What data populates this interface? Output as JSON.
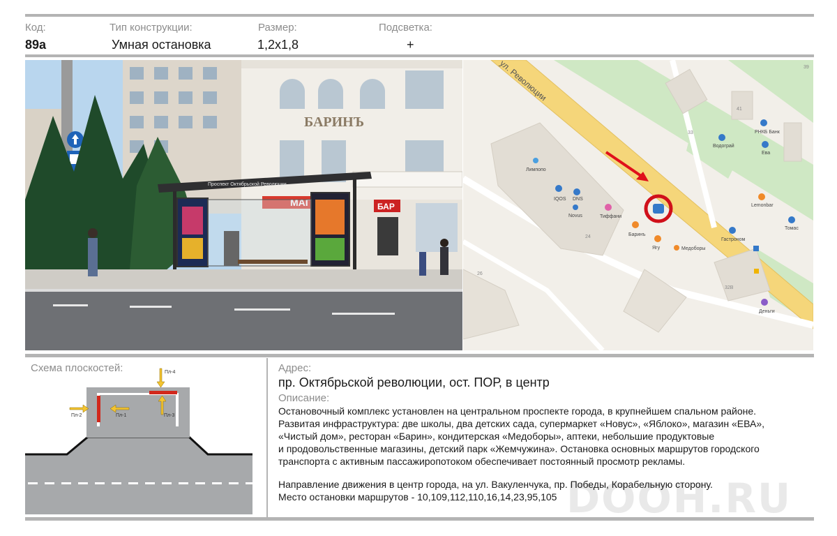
{
  "header": {
    "code_label": "Код:",
    "code_value": "89а",
    "type_label": "Тип конструкции:",
    "type_value": "Умная остановка",
    "size_label": "Размер:",
    "size_value": "1,2х1,8",
    "light_label": "Подсветка:",
    "light_value": "+"
  },
  "photo": {
    "building_sign": "БАРИНЪ",
    "shop_sign": "МАГ",
    "bar_sign": "БАР",
    "shelter_roof_text": "Проспект Октябрьской Революции"
  },
  "map": {
    "street_label": "ул. Революции",
    "pins": {
      "limpopo": "Лимпопо",
      "iqos": "IQOS",
      "dns": "DNS",
      "novus": "Novus",
      "tiffani": "Тиффани",
      "barin": "Баринъ",
      "yagu": "Ягу",
      "medobory": "Медоборы",
      "vodograi": "Водограй",
      "rnkb": "РНКБ Банк",
      "eva": "Ева",
      "lemonbar": "Lemonbar",
      "gastronom": "Гастроном",
      "tomas": "Томас",
      "dengi": "Деньги"
    },
    "house_numbers": {
      "h41": "41",
      "h33": "33",
      "h24": "24",
      "h26": "26",
      "h32v": "32В",
      "h39": "39"
    },
    "colors": {
      "road": "#f5d67a",
      "green": "#cfe8c4",
      "building": "#e2ddd4",
      "marker": "#d0101a",
      "arrow": "#e0101a"
    }
  },
  "scheme": {
    "title": "Схема плоскостей:",
    "labels": {
      "p1": "Пл-1",
      "p2": "Пл-2",
      "p3": "Пл-3",
      "p4": "Пл-4"
    }
  },
  "address": {
    "label": "Адрес:",
    "value": "пр. Октябрьской революции, ост. ПОР, в центр"
  },
  "description": {
    "label": "Описание:",
    "lines": [
      "Остановочный комплекс установлен на центральном проспекте города, в крупнейшем спальном районе.",
      "Развитая инфраструктура: две школы, два детских сада, супермаркет «Новус», «Яблоко», магазин «ЕВА»,",
      "«Чистый дом», ресторан «Барин», кондитерская «Медоборы», аптеки, небольшие продуктовые",
      "и продовольственные магазины, детский парк «Жемчужина». Остановка основных маршрутов городского",
      "транспорта с активным пассажиропотоком обеспечивает постоянный просмотр рекламы."
    ],
    "direction": "Направление движения в центр города, на ул. Вакуленчука, пр. Победы, Корабельную сторону.",
    "routes": "Место остановки маршрутов - 10,109,112,110,16,14,23,95,105"
  },
  "watermark": "DOOH.RU"
}
